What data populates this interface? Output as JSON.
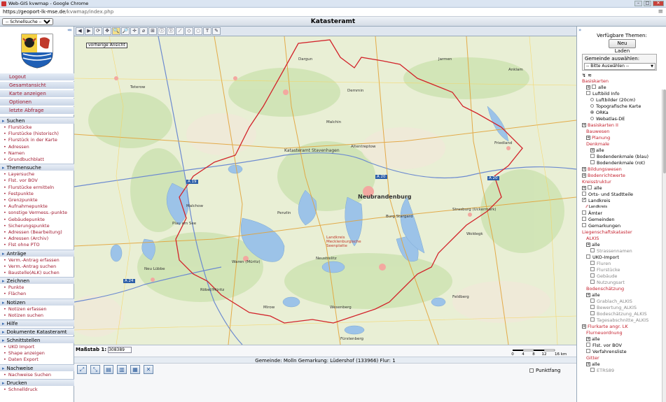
{
  "window": {
    "title": "Web-GIS kvwmap - Google Chrome"
  },
  "url": {
    "host": "https://geoport-lk-mse.de",
    "path": "/kvwmap/index.php"
  },
  "header": {
    "title": "Katasteramt",
    "quicksearch": "-- Schnellsuche --"
  },
  "sidebar": {
    "nav": [
      "Logout",
      "Gesamtansicht",
      "Karte anzeigen",
      "Optionen",
      "letzte Abfrage"
    ],
    "sections": [
      {
        "title": "Suchen",
        "items": [
          "Flurstücke",
          "Flurstücke (historisch)",
          "Flurstück in der Karte",
          "Adressen",
          "Namen",
          "Grundbuchblatt"
        ]
      },
      {
        "title": "Themensuche",
        "items": [
          "Layersuche",
          "Flst. vor BOV",
          "Flurstücke ermitteln",
          "Festpunkte",
          "Grenzpunkte",
          "Aufnahmepunkte",
          "sonstige Vermess.-punkte",
          "Gebäudepunkte",
          "Sicherungspunkte",
          "Adressen (Bearbeitung)",
          "Adressen (Archiv)",
          "Flst ohne PTO"
        ]
      },
      {
        "title": "Anträge",
        "items": [
          "Verm.-Antrag erfassen",
          "Verm.-Antrag suchen",
          "Baustelle(ALK) suchen"
        ]
      },
      {
        "title": "Zeichnen",
        "items": [
          "Punkte",
          "Flächen"
        ]
      },
      {
        "title": "Notizen",
        "items": [
          "Notizen erfassen",
          "Notizen suchen"
        ]
      },
      {
        "title": "Hilfe",
        "items": []
      },
      {
        "title": "Dokumente Katasteramt",
        "items": []
      },
      {
        "title": "Schnittstellen",
        "items": [
          "UKO Import",
          "Shape anzeigen",
          "Daten Export"
        ]
      },
      {
        "title": "Nachweise",
        "items": [
          "Nachweise Suchen"
        ]
      },
      {
        "title": "Drucken",
        "items": [
          "Schnelldruck"
        ]
      }
    ]
  },
  "toolbar": {
    "tooltip": "vorherige Ansicht"
  },
  "map": {
    "labels": [
      "Katasteramt Stavenhagen",
      "Neubrandenburg",
      "Landkreis Mecklenburgische Seenplatte",
      "Malchin",
      "Waren (Müritz)",
      "Neustrelitz",
      "Altentreptow",
      "Demmin",
      "Penzlin",
      "Burg Stargard",
      "Woldegk",
      "Friedland",
      "Röbel/Müritz",
      "Mirow",
      "Wesenberg",
      "Feldberg",
      "Teterow",
      "Dargun",
      "Jarmen",
      "Anklam",
      "Strasburg (Uckermark)",
      "Malchow",
      "Plau am See",
      "Neu Lübbe",
      "Fürstenberg"
    ],
    "roads": [
      "A 19",
      "A 20",
      "A 20",
      "A 24"
    ]
  },
  "status": {
    "scale_label": "Maßstab 1:",
    "scale_value": "308389",
    "scalebar": [
      "0",
      "4",
      "8",
      "12",
      "16 km"
    ],
    "location": "Gemeinde: Molln Gemarkung: Lüdershof (133966) Flur: 1",
    "punktfang": "Punktfang"
  },
  "right": {
    "title": "Verfügbare Themen:",
    "reload": "Neu Laden",
    "gem_label": "Gemeinde auswählen:",
    "gem_select": "-- Bitte Auswählen --",
    "tree": [
      [
        "Basiskarten",
        "red",
        0,
        "",
        ""
      ],
      [
        "alle",
        "",
        1,
        "ex",
        "cb"
      ],
      [
        "Luftbild Info",
        "",
        1,
        "",
        "cb"
      ],
      [
        "Luftbilder (20cm)",
        "",
        2,
        "",
        "rb"
      ],
      [
        "Topografische Karte",
        "",
        2,
        "",
        "rb"
      ],
      [
        "ORKa",
        "",
        2,
        "",
        "rbon"
      ],
      [
        "Webatlas-DE",
        "",
        2,
        "",
        "rb"
      ],
      [
        "Basiskarten II",
        "red",
        0,
        "ex",
        ""
      ],
      [
        "Bauwesen",
        "red",
        1,
        "",
        ""
      ],
      [
        "Planung",
        "red",
        1,
        "ex",
        ""
      ],
      [
        "Denkmale",
        "red",
        1,
        "",
        ""
      ],
      [
        "alle",
        "",
        2,
        "ex",
        ""
      ],
      [
        "Bodendenkmale (blau)",
        "",
        2,
        "",
        "cb"
      ],
      [
        "Bodendenkmale (rot)",
        "",
        2,
        "",
        "cb"
      ],
      [
        "Bildungswesen",
        "red",
        0,
        "ex",
        ""
      ],
      [
        "Bodenrichtwerte",
        "red",
        0,
        "ex",
        ""
      ],
      [
        "Kreisstruktur",
        "red",
        0,
        "",
        ""
      ],
      [
        "alle",
        "",
        0,
        "ex",
        "cb"
      ],
      [
        "Orts- und Stadtteile",
        "",
        0,
        "",
        "cb"
      ],
      [
        "Landkreis",
        "",
        0,
        "",
        "cbon"
      ],
      [
        "Landkreis",
        "sm",
        1,
        "",
        ""
      ],
      [
        "Ämter",
        "",
        0,
        "",
        "cb"
      ],
      [
        "Gemeinden",
        "",
        0,
        "",
        "cb"
      ],
      [
        "Gemarkungen",
        "",
        0,
        "",
        "cb"
      ],
      [
        "Liegenschaftskataster",
        "red",
        0,
        "",
        ""
      ],
      [
        "ALKIS",
        "red",
        1,
        "",
        ""
      ],
      [
        "alle",
        "",
        1,
        "ex",
        ""
      ],
      [
        "Strassennamen",
        "grey",
        2,
        "",
        "cb"
      ],
      [
        "UKO-Import",
        "",
        1,
        "",
        "cb"
      ],
      [
        "Fluren",
        "grey",
        2,
        "",
        "cb"
      ],
      [
        "Flurstücke",
        "grey",
        2,
        "",
        "cb"
      ],
      [
        "Gebäude",
        "grey",
        2,
        "",
        "cb"
      ],
      [
        "Nutzungsart",
        "grey",
        2,
        "",
        "cb"
      ],
      [
        "Bodenschätzung",
        "red",
        1,
        "",
        ""
      ],
      [
        "alle",
        "",
        1,
        "ex",
        ""
      ],
      [
        "Grablach_ALKIS",
        "grey",
        2,
        "",
        "cb"
      ],
      [
        "Bewertung_ALKIS",
        "grey",
        2,
        "",
        "cb"
      ],
      [
        "Bodeschätzung_ALKIS",
        "grey",
        2,
        "",
        "cb"
      ],
      [
        "Tagesabschnitte_ALKIS",
        "grey",
        2,
        "",
        "cb"
      ],
      [
        "Flurkarte angr. LK",
        "red",
        0,
        "ex",
        ""
      ],
      [
        "Flurneuordnung",
        "red",
        1,
        "",
        ""
      ],
      [
        "alle",
        "",
        1,
        "ex",
        ""
      ],
      [
        "Flst. vor BOV",
        "",
        1,
        "",
        "cb"
      ],
      [
        "Verfahrensliste",
        "",
        1,
        "",
        "cb"
      ],
      [
        "Gitter",
        "red",
        1,
        "",
        ""
      ],
      [
        "alle",
        "",
        1,
        "ex",
        ""
      ],
      [
        "ETRS89",
        "grey",
        2,
        "",
        "cb"
      ]
    ]
  }
}
